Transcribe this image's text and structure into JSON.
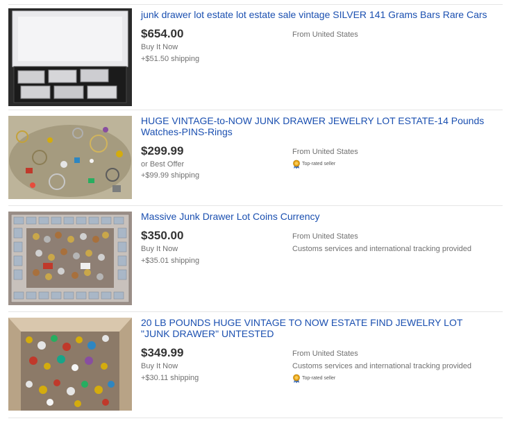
{
  "listings": [
    {
      "title": "junk drawer lot estate lot estate sale vintage SILVER 141 Grams Bars Rare Cars",
      "price": "$654.00",
      "format": "Buy It Now",
      "shipping": "+$51.50 shipping",
      "location": "From United States",
      "image_icon": "silver-bars-photo"
    },
    {
      "title": "HUGE VINTAGE-to-NOW JUNK DRAWER JEWELRY LOT ESTATE-14 Pounds Watches-PINS-Rings",
      "price": "$299.99",
      "format": "or Best Offer",
      "shipping": "+$99.99 shipping",
      "location": "From United States",
      "badge": "Top-rated seller",
      "image_icon": "jewelry-pile-photo"
    },
    {
      "title": "Massive Junk Drawer Lot Coins Currency",
      "price": "$350.00",
      "format": "Buy It Now",
      "shipping": "+$35.01 shipping",
      "location": "From United States",
      "customs": "Customs services and international tracking provided",
      "image_icon": "coin-collection-photo"
    },
    {
      "title": "20 LB POUNDS HUGE VINTAGE TO NOW ESTATE FIND JEWELRY LOT \"JUNK DRAWER\" UNTESTED",
      "price": "$349.99",
      "format": "Buy It Now",
      "shipping": "+$30.11 shipping",
      "location": "From United States",
      "customs": "Customs services and international tracking provided",
      "badge": "Top-rated seller",
      "image_icon": "jewelry-box-photo"
    }
  ],
  "colors": {
    "link": "#1a4fb0",
    "price": "#333333",
    "meta": "#707070",
    "divider": "#e5e5e5",
    "badge_gold": "#e8a317"
  }
}
